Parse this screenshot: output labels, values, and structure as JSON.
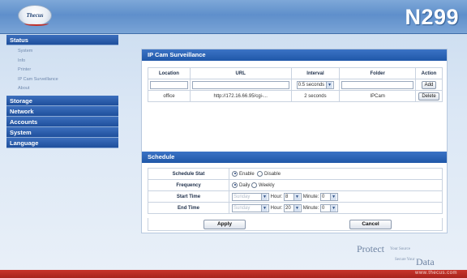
{
  "header": {
    "logo_text": "Thecus",
    "model": "N299"
  },
  "sidebar": {
    "sections": [
      {
        "label": "Status",
        "items": [
          "System",
          "Info",
          "Printer",
          "IP Cam Surveillance",
          "About"
        ]
      },
      {
        "label": "Storage"
      },
      {
        "label": "Network"
      },
      {
        "label": "Accounts"
      },
      {
        "label": "System"
      },
      {
        "label": "Language"
      }
    ]
  },
  "ipcam": {
    "title": "IP Cam Surveillance",
    "columns": [
      "Location",
      "URL",
      "Interval",
      "Folder",
      "Action"
    ],
    "new_row": {
      "interval": "0.5 seconds",
      "action": "Add"
    },
    "rows": [
      {
        "location": "office",
        "url": "http://172.16.66.95/cgi-...",
        "interval": "2 seconds",
        "folder": "IPCam",
        "action": "Delete"
      }
    ]
  },
  "schedule": {
    "title": "Schedule",
    "stat_label": "Schedule Stat",
    "stat_options": [
      "Enable",
      "Disable"
    ],
    "stat_selected": "Enable",
    "freq_label": "Frequency",
    "freq_options": [
      "Daily",
      "Weekly"
    ],
    "freq_selected": "Daily",
    "start_label": "Start Time",
    "end_label": "End Time",
    "day_value": "Sunday",
    "hour_label": "Hour:",
    "minute_label": "Minute:",
    "start_hour": "8",
    "start_minute": "0",
    "end_hour": "20",
    "end_minute": "0",
    "apply": "Apply",
    "cancel": "Cancel"
  },
  "branding": {
    "protect": "Protect",
    "your_source": "Your Source",
    "secure_your": "Secure Your",
    "data": "Data",
    "url": "www.thecus.com"
  }
}
